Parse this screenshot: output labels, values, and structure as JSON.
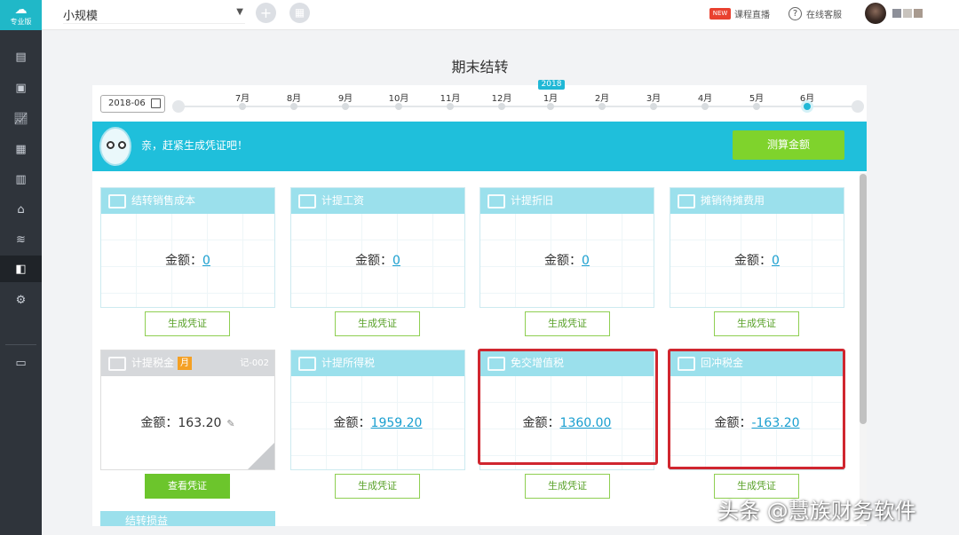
{
  "app": {
    "edition": "专业版",
    "logo_icon": "cloud-icon"
  },
  "sidebar": {
    "items": [
      {
        "icon": "ledger-icon"
      },
      {
        "icon": "voucher-icon"
      },
      {
        "icon": "chart-icon"
      },
      {
        "icon": "report-icon"
      },
      {
        "icon": "calendar-icon"
      },
      {
        "icon": "bank-icon"
      },
      {
        "icon": "coins-icon"
      },
      {
        "icon": "period-close-icon",
        "active": true
      },
      {
        "icon": "settings-icon"
      },
      {
        "icon": "gift-icon"
      }
    ]
  },
  "topbar": {
    "company": "小规模",
    "live_label": "课程直播",
    "live_badge": "NEW",
    "help_label": "在线客服",
    "help_glyph": "?"
  },
  "page": {
    "title": "期末结转"
  },
  "period": {
    "date": "2018-06",
    "year_badge": "2018",
    "months": [
      "7月",
      "8月",
      "9月",
      "10月",
      "11月",
      "12月",
      "1月",
      "2月",
      "3月",
      "4月",
      "5月",
      "6月"
    ],
    "current_index": 11
  },
  "banner": {
    "text": "亲，赶紧生成凭证吧！",
    "button": "测算金额"
  },
  "amount_label": "金额：",
  "cards": [
    {
      "title": "结转销售成本",
      "amount": "0",
      "action": "生成凭证"
    },
    {
      "title": "计提工资",
      "amount": "0",
      "action": "生成凭证"
    },
    {
      "title": "计提折旧",
      "amount": "0",
      "action": "生成凭证"
    },
    {
      "title": "摊销待摊费用",
      "amount": "0",
      "action": "生成凭证"
    },
    {
      "title": "计提税金",
      "badge": "月",
      "code": "记-002",
      "amount": "163.20",
      "action": "查看凭证"
    },
    {
      "title": "计提所得税",
      "amount": "1959.20",
      "action": "生成凭证"
    },
    {
      "title": "免交增值税",
      "amount": "1360.00",
      "action": "生成凭证"
    },
    {
      "title": "回冲税金",
      "amount": "-163.20",
      "action": "生成凭证"
    }
  ],
  "next_card": {
    "title": "结转损益"
  },
  "watermark": "头条 @慧族财务软件",
  "colors": {
    "accent": "#1fbfdb",
    "card_header": "#9be0ec",
    "green": "#6cc52c",
    "highlight": "#d0262f",
    "sidebar": "#2f343b"
  }
}
